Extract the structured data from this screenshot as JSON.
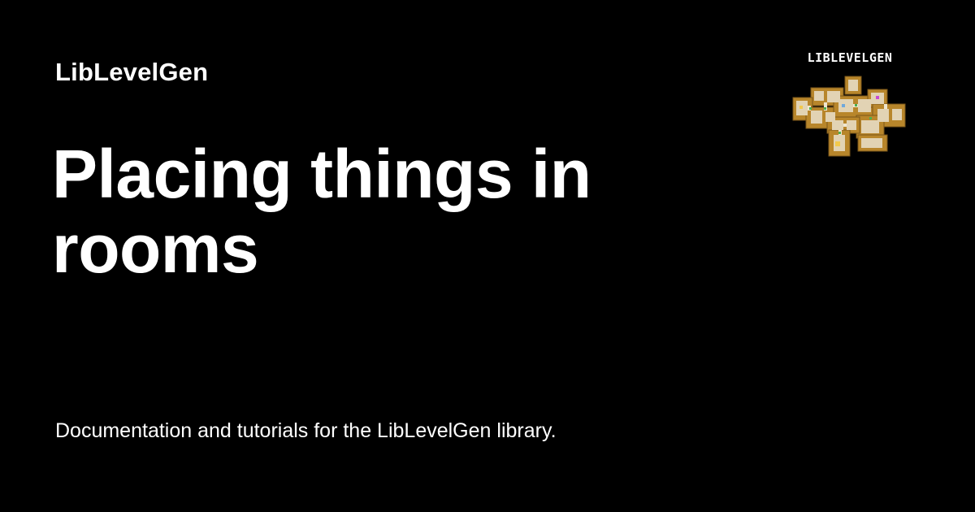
{
  "site": {
    "name": "LibLevelGen"
  },
  "page": {
    "title": "Placing things in rooms",
    "description": "Documentation and tutorials for the LibLevelGen library."
  },
  "logo": {
    "wordmark": "LIBLEVELGEN",
    "icon_name": "dungeon-map-icon"
  },
  "colors": {
    "background": "#000000",
    "text": "#ffffff",
    "map_wall": "#b8862b",
    "map_floor": "#e2d3b4",
    "map_door": "#4caf50",
    "map_accent": "#c84bd4"
  }
}
